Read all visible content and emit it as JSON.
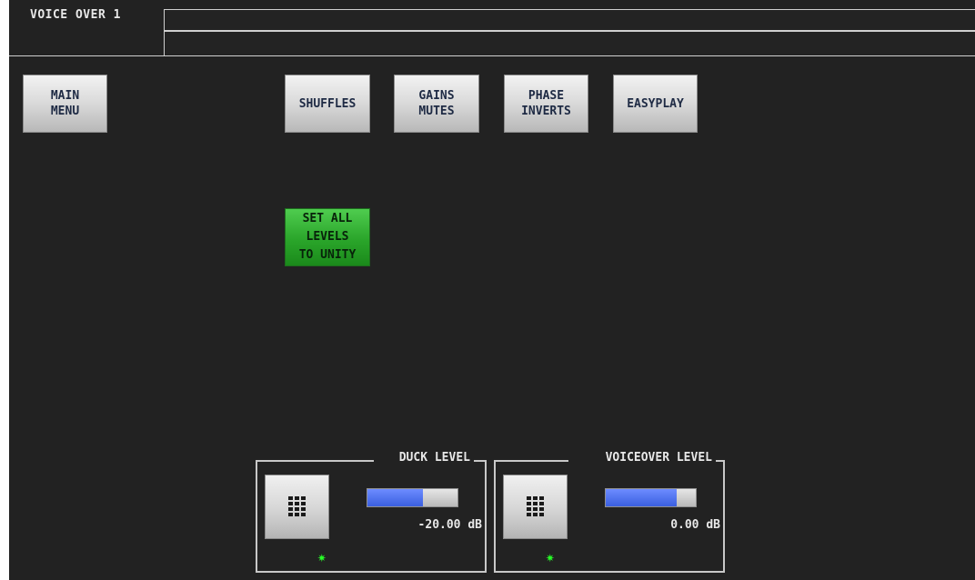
{
  "window": {
    "title": "VOICE OVER 1"
  },
  "nav_buttons": {
    "main_menu": "MAIN\nMENU",
    "shuffles": "SHUFFLES",
    "gains_mutes": "GAINS\nMUTES",
    "phase_inverts": "PHASE\nINVERTS",
    "easyplay": "EASYPLAY"
  },
  "actions": {
    "set_all_unity": "SET ALL\nLEVELS\nTO UNITY"
  },
  "controls": {
    "duck_level": {
      "label": "DUCK LEVEL",
      "value": "-20.00 dB",
      "level_fraction": 0.62,
      "keypad_icon": "keypad-icon",
      "indicator_icon": "status-star-icon"
    },
    "voiceover_level": {
      "label": "VOICEOVER LEVEL",
      "value": "0.00 dB",
      "level_fraction": 0.79,
      "keypad_icon": "keypad-icon",
      "indicator_icon": "status-star-icon"
    }
  },
  "colors": {
    "panel_background": "#222222",
    "green_button": "#2aa52a",
    "meter_fill": "#3a5fe0",
    "indicator": "#27ff27"
  }
}
